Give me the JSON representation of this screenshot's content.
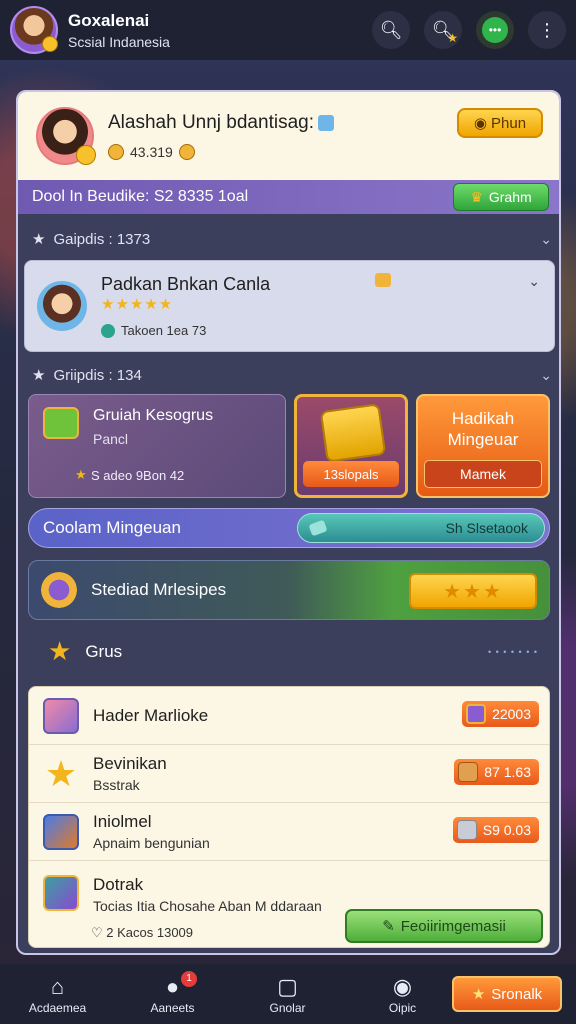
{
  "header": {
    "title": "Goxalenai",
    "subtitle": "Scsial Indanesia",
    "icons": [
      "search-icon",
      "search-star-icon",
      "chat-icon",
      "more-icon"
    ]
  },
  "profile": {
    "name": "Alashah Unnj bdantisag:",
    "coins": "43.319",
    "action_label": "Phun"
  },
  "promo_bar": {
    "text": "Dool In Beudike: S2 8335 1oal",
    "button_label": "Grahm"
  },
  "groups_1": {
    "heading": "Gaipdis : 1373"
  },
  "friend": {
    "name": "Padkan Bnkan Canla",
    "stars": "★★★★★",
    "sub": "Takoen 1ea 73"
  },
  "groups_2": {
    "heading": "Griipdis : 134"
  },
  "card_left": {
    "title": "Gruiah Kesogrus",
    "subtitle": "Pancl",
    "meta": "S adeo 9Bon 42"
  },
  "card_gold": {
    "label": "13slopals"
  },
  "card_orange": {
    "title": "Hadikah Mingeuar",
    "label": "Mamek"
  },
  "mid_bar": {
    "label": "Coolam Mingeuan",
    "pill_label": "Sh Slsetaook"
  },
  "green_bar": {
    "label": "Stediad Mrlesipes",
    "stars": "★★★"
  },
  "grus": {
    "label": "Grus",
    "mini": "• • • • • • •"
  },
  "list": [
    {
      "name": "Hader Marlioke",
      "sub": "",
      "price": "22003"
    },
    {
      "name": "Bevinikan",
      "sub": "Bsstrak",
      "price": "87 1.63"
    },
    {
      "name": "Iniolmel",
      "sub": "Apnaim bengunian",
      "price": "S9 0.03"
    },
    {
      "name": "Dotrak",
      "sub": "Tocias Itia Chosahe Aban  M ddaraan",
      "foot": "2 Kacos 13009",
      "button": "Feoiirimgemasii"
    }
  ],
  "bottom_nav": {
    "items": [
      "Acdaemea",
      "Aaneets",
      "Gnolar",
      "Oipic"
    ],
    "badge": "1",
    "button_label": "Sronalk"
  },
  "colors": {
    "accent_yellow": "#f0a500",
    "accent_green": "#2fa53a",
    "accent_orange": "#e85a1a",
    "purple": "#6f5ab2"
  }
}
